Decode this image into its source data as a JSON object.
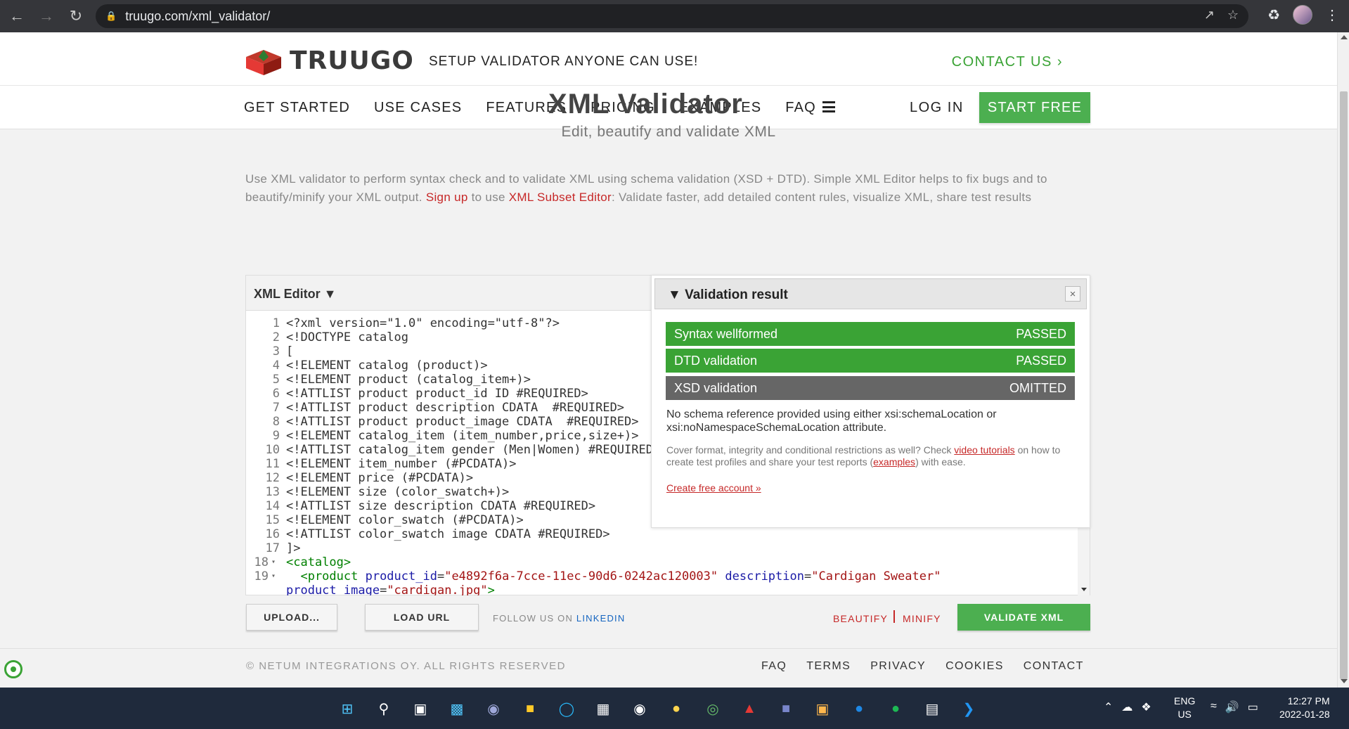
{
  "browser": {
    "url": "truugo.com/xml_validator/"
  },
  "header": {
    "brand": "TRUUGO",
    "tagline": "SETUP VALIDATOR ANYONE CAN USE!",
    "contact": "CONTACT US ›"
  },
  "nav": {
    "items": [
      "GET STARTED",
      "USE CASES",
      "FEATURES",
      "PRICING",
      "EXAMPLES",
      "FAQ"
    ],
    "login": "LOG IN",
    "start_free": "START FREE"
  },
  "hero": {
    "title": "XML Validator",
    "subtitle": "Edit, beautify and validate XML",
    "intro_1": "Use XML validator to perform syntax check and to validate XML using schema validation (XSD + DTD). Simple XML Editor helps to fix bugs and to beautify/minify your XML output. ",
    "intro_signup": "Sign up",
    "intro_2": " to use ",
    "intro_subset": "XML Subset Editor",
    "intro_3": ": Validate faster, add detailed content rules, visualize XML, share test results"
  },
  "editor": {
    "title": "XML Editor ▼",
    "lines": [
      "<?xml version=\"1.0\" encoding=\"utf-8\"?>",
      "<!DOCTYPE catalog",
      "[",
      "<!ELEMENT catalog (product)>",
      "<!ELEMENT product (catalog_item+)>",
      "<!ATTLIST product product_id ID #REQUIRED>",
      "<!ATTLIST product description CDATA  #REQUIRED>",
      "<!ATTLIST product product_image CDATA  #REQUIRED>",
      "<!ELEMENT catalog_item (item_number,price,size+)>",
      "<!ATTLIST catalog_item gender (Men|Women) #REQUIRED>",
      "<!ELEMENT item_number (#PCDATA)>",
      "<!ELEMENT price (#PCDATA)>",
      "<!ELEMENT size (color_swatch+)>",
      "<!ATTLIST size description CDATA #REQUIRED>",
      "<!ELEMENT color_swatch (#PCDATA)>",
      "<!ATTLIST color_swatch image CDATA #REQUIRED>",
      "]>"
    ],
    "line18": "<catalog>",
    "line19_a": "  <product ",
    "line19_attr1": "product_id",
    "line19_val1": "\"e4892f6a-7cce-11ec-90d6-0242ac120003\"",
    "line19_attr2": "description",
    "line19_val2": "\"Cardigan Sweater\"",
    "line19_cont_attr": "product_image",
    "line19_cont_val": "\"cardigan.jpg\"",
    "line19_cont_end": ">",
    "upload": "UPLOAD...",
    "load_url": "LOAD URL",
    "follow": "FOLLOW US ON ",
    "linkedin": "LINKEDIN",
    "beautify": "BEAUTIFY",
    "minify": "MINIFY",
    "validate": "VALIDATE XML"
  },
  "validation": {
    "title": "▼ Validation result",
    "close": "×",
    "rows": [
      {
        "label": "Syntax wellformed",
        "status": "PASSED"
      },
      {
        "label": "DTD validation",
        "status": "PASSED"
      },
      {
        "label": "XSD validation",
        "status": "OMITTED"
      }
    ],
    "message": "No schema reference provided using either xsi:schemaLocation or xsi:noNamespaceSchemaLocation attribute.",
    "note_1": "Cover format, integrity and conditional restrictions as well? Check ",
    "note_link1": "video tutorials",
    "note_2": " on how to create test profiles and share your test reports (",
    "note_link2": "examples",
    "note_3": ") with ease.",
    "create": "Create free account »"
  },
  "footer": {
    "copyright": "© NETUM INTEGRATIONS OY. ALL RIGHTS RESERVED",
    "links": [
      "FAQ",
      "TERMS",
      "PRIVACY",
      "COOKIES",
      "CONTACT"
    ]
  },
  "taskbar": {
    "lang1": "ENG",
    "lang2": "US",
    "time": "12:27 PM",
    "date": "2022-01-28"
  },
  "colors": {
    "brand_green": "#4caf50",
    "pass_green": "#3aa335",
    "omit_gray": "#666666",
    "link_red": "#c62828"
  }
}
